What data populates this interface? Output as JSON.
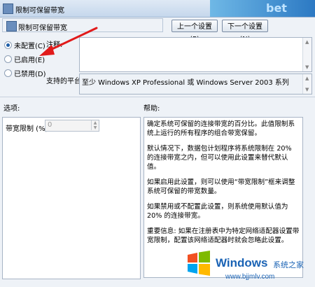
{
  "window": {
    "title": "限制可保留带宽"
  },
  "banner": {
    "text": "bet"
  },
  "header": {
    "title": "限制可保留带宽"
  },
  "buttons": {
    "prev": "上一个设置(P)",
    "next": "下一个设置(N)"
  },
  "options": [
    {
      "label": "未配置(C)",
      "checked": true
    },
    {
      "label": "已启用(E)",
      "checked": false
    },
    {
      "label": "已禁用(D)",
      "checked": false
    }
  ],
  "comment": {
    "label": "注释:",
    "value": ""
  },
  "platform": {
    "label": "支持的平台:",
    "value": "至少 Windows XP Professional 或 Windows Server 2003 系列"
  },
  "sections": {
    "options": "选项:",
    "help": "帮助:"
  },
  "bandwidth": {
    "label": "带宽限制 (%):",
    "value": "0"
  },
  "help_paragraphs": [
    "确定系统可保留的连接带宽的百分比。此值限制系统上运行的所有程序的组合带宽保留。",
    "默认情况下，数据包计划程序将系统限制在 20% 的连接带宽之内，但可以使用此设置来替代默认值。",
    "如果启用此设置，则可以使用“带宽限制”框来调整系统可保留的带宽数量。",
    "如果禁用或不配置此设置，则系统使用默认值为 20% 的连接带宽。",
    "重要信息: 如果在注册表中为特定网络适配器设置带宽限制，配置该网络适配器时就会忽略此设置。"
  ],
  "watermark": {
    "word": "Windows",
    "cn": "系统之家",
    "url": "www.bjjmlv.com"
  },
  "colors": {
    "arrow": "#e11a1a",
    "accent": "#1a63b5"
  }
}
